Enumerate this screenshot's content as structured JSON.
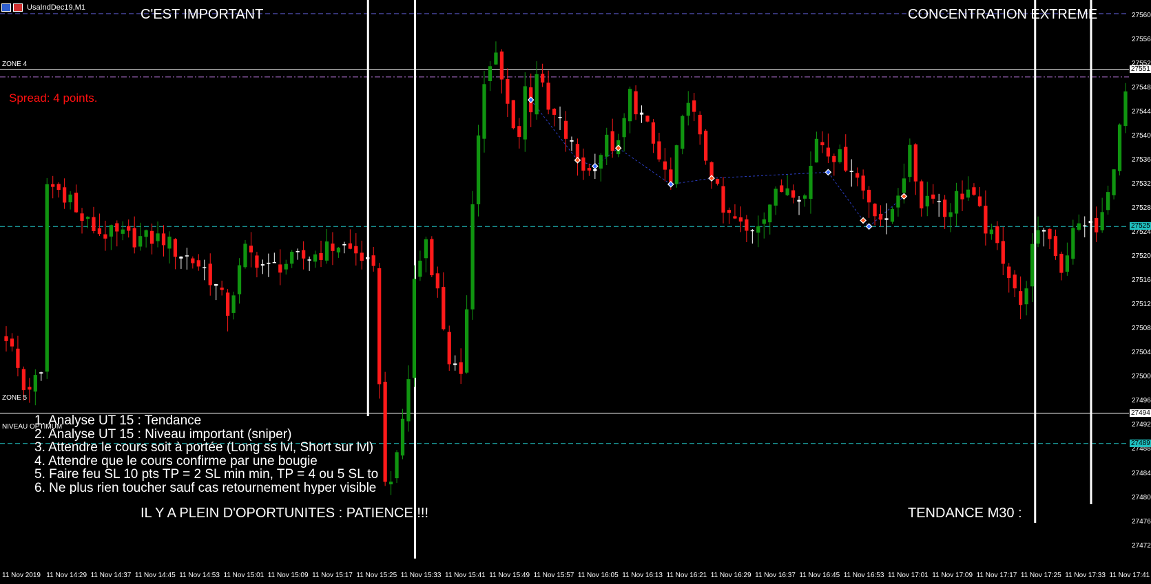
{
  "window": {
    "title": "UsaIndDec19,M1"
  },
  "annotations": {
    "top_left": "C'EST IMPORTANT",
    "top_right": "CONCENTRATION EXTREME",
    "bottom_left": "IL Y A PLEIN D'OPORTUNITES : PATIENCE !!!",
    "bottom_right": "TENDANCE M30 :",
    "spread": "Spread: 4 points."
  },
  "zones": {
    "zone4": "ZONE 4",
    "zone5": "ZONE 5",
    "niveau": "NIVEAU OPTIMUM"
  },
  "checklist": [
    "1. Analyse UT 15 : Tendance",
    "2. Analyse UT 15 : Niveau important (sniper)",
    "3. Attendre le cours soit à portée (Long ss lvl, Short sur lvl)",
    "4. Attendre que le cours confirme par une bougie",
    "5. Faire feu SL 10 pts TP = 2 SL min min, TP = 4 ou 5 SL to",
    "6. Ne plus rien toucher sauf cas retournement hyper visible"
  ],
  "price_axis": {
    "ticks": [
      "27560",
      "27556",
      "27552",
      "27548",
      "27544",
      "27540",
      "27536",
      "27532",
      "27528",
      "27524",
      "27520",
      "27516",
      "27512",
      "27508",
      "27504",
      "27500",
      "27496",
      "27492",
      "27488",
      "27484",
      "27480",
      "27476",
      "27472"
    ],
    "badges": [
      {
        "label": "27551",
        "price": 27551,
        "color": "#ffffff"
      },
      {
        "label": "27525",
        "price": 27525,
        "color": "#20c0c0"
      },
      {
        "label": "27494",
        "price": 27494,
        "color": "#ffffff"
      },
      {
        "label": "27489",
        "price": 27489,
        "color": "#20c0c0"
      }
    ]
  },
  "time_axis": [
    "11 Nov 2019",
    "11 Nov 14:29",
    "11 Nov 14:37",
    "11 Nov 14:45",
    "11 Nov 14:53",
    "11 Nov 15:01",
    "11 Nov 15:09",
    "11 Nov 15:17",
    "11 Nov 15:25",
    "11 Nov 15:33",
    "11 Nov 15:41",
    "11 Nov 15:49",
    "11 Nov 15:57",
    "11 Nov 16:05",
    "11 Nov 16:13",
    "11 Nov 16:21",
    "11 Nov 16:29",
    "11 Nov 16:37",
    "11 Nov 16:45",
    "11 Nov 16:53",
    "11 Nov 17:01",
    "11 Nov 17:09",
    "11 Nov 17:17",
    "11 Nov 17:25",
    "11 Nov 17:33",
    "11 Nov 17:41"
  ],
  "chart_data": {
    "type": "candlestick",
    "symbol": "UsaIndDec19",
    "timeframe": "M1",
    "ylim": [
      27469,
      27562
    ],
    "colors": {
      "bull": "#109410",
      "bear": "#ff1a1a",
      "doji": "#ffffff",
      "background": "#000000"
    },
    "horizontal_levels": [
      {
        "price": 27560.3,
        "style": "dash",
        "color": "#5a58c8"
      },
      {
        "price": 27551,
        "style": "solid",
        "color": "#ffffff"
      },
      {
        "price": 27549.8,
        "style": "dashdot",
        "color": "#b070d0"
      },
      {
        "price": 27525,
        "style": "dash",
        "color": "#20c0c0"
      },
      {
        "price": 27494,
        "style": "solid",
        "color": "#ffffff"
      },
      {
        "price": 27489,
        "style": "dash",
        "color": "#20c0c0"
      }
    ],
    "vertical_markers": [
      {
        "time_index": 8.05,
        "color": "#ffffff"
      },
      {
        "time_index": 9.1,
        "color": "#ffffff"
      },
      {
        "time_index": 22.95,
        "color": "#ffffff"
      },
      {
        "time_index": 24.2,
        "color": "#ffffff"
      }
    ],
    "anchors": [
      {
        "i": 0,
        "p": 27507
      },
      {
        "i": 1.5,
        "p": 27503
      },
      {
        "i": 3,
        "p": 27498
      },
      {
        "i": 6,
        "p": 27500
      },
      {
        "i": 6.5,
        "p": 27505
      },
      {
        "i": 7,
        "p": 27532
      },
      {
        "i": 9,
        "p": 27531
      },
      {
        "i": 11,
        "p": 27530
      },
      {
        "i": 12,
        "p": 27527
      },
      {
        "i": 16,
        "p": 27524
      },
      {
        "i": 22,
        "p": 27523
      },
      {
        "i": 27,
        "p": 27523
      },
      {
        "i": 29,
        "p": 27521
      },
      {
        "i": 31,
        "p": 27520
      },
      {
        "i": 34,
        "p": 27518
      },
      {
        "i": 36,
        "p": 27515
      },
      {
        "i": 38,
        "p": 27511
      },
      {
        "i": 41,
        "p": 27521
      },
      {
        "i": 45,
        "p": 27518
      },
      {
        "i": 48,
        "p": 27519
      },
      {
        "i": 52,
        "p": 27520
      },
      {
        "i": 57,
        "p": 27522
      },
      {
        "i": 61,
        "p": 27520
      },
      {
        "i": 63,
        "p": 27517
      },
      {
        "i": 64,
        "p": 27500
      },
      {
        "i": 65,
        "p": 27482
      },
      {
        "i": 67,
        "p": 27486
      },
      {
        "i": 69,
        "p": 27500
      },
      {
        "i": 70,
        "p": 27516
      },
      {
        "i": 72,
        "p": 27523
      },
      {
        "i": 74,
        "p": 27514
      },
      {
        "i": 76,
        "p": 27503
      },
      {
        "i": 78,
        "p": 27499
      },
      {
        "i": 79,
        "p": 27512
      },
      {
        "i": 80,
        "p": 27530
      },
      {
        "i": 81,
        "p": 27540
      },
      {
        "i": 82,
        "p": 27549
      },
      {
        "i": 84,
        "p": 27553
      },
      {
        "i": 86,
        "p": 27545
      },
      {
        "i": 88,
        "p": 27540
      },
      {
        "i": 89,
        "p": 27548
      },
      {
        "i": 90,
        "p": 27545
      },
      {
        "i": 91,
        "p": 27551
      },
      {
        "i": 93,
        "p": 27544
      },
      {
        "i": 95,
        "p": 27542
      },
      {
        "i": 98,
        "p": 27536
      },
      {
        "i": 100,
        "p": 27534
      },
      {
        "i": 103,
        "p": 27539
      },
      {
        "i": 105,
        "p": 27538
      },
      {
        "i": 107,
        "p": 27547
      },
      {
        "i": 110,
        "p": 27541
      },
      {
        "i": 112,
        "p": 27536
      },
      {
        "i": 114,
        "p": 27532
      },
      {
        "i": 116,
        "p": 27542
      },
      {
        "i": 117,
        "p": 27547
      },
      {
        "i": 119,
        "p": 27539
      },
      {
        "i": 121,
        "p": 27534
      },
      {
        "i": 123,
        "p": 27527
      },
      {
        "i": 125,
        "p": 27526
      },
      {
        "i": 127,
        "p": 27524
      },
      {
        "i": 129,
        "p": 27526
      },
      {
        "i": 131,
        "p": 27529
      },
      {
        "i": 134,
        "p": 27532
      },
      {
        "i": 137,
        "p": 27530
      },
      {
        "i": 139,
        "p": 27540
      },
      {
        "i": 142,
        "p": 27537
      },
      {
        "i": 145,
        "p": 27535
      },
      {
        "i": 147,
        "p": 27531
      },
      {
        "i": 149,
        "p": 27528
      },
      {
        "i": 151,
        "p": 27525
      },
      {
        "i": 153,
        "p": 27531
      },
      {
        "i": 155,
        "p": 27537
      },
      {
        "i": 157,
        "p": 27529
      },
      {
        "i": 159,
        "p": 27531
      },
      {
        "i": 161,
        "p": 27527
      },
      {
        "i": 163,
        "p": 27530
      },
      {
        "i": 165,
        "p": 27531
      },
      {
        "i": 167,
        "p": 27527
      },
      {
        "i": 169,
        "p": 27523
      },
      {
        "i": 171,
        "p": 27520
      },
      {
        "i": 173,
        "p": 27515
      },
      {
        "i": 174,
        "p": 27511
      },
      {
        "i": 176,
        "p": 27521
      },
      {
        "i": 178,
        "p": 27525
      },
      {
        "i": 180,
        "p": 27521
      },
      {
        "i": 181,
        "p": 27518
      },
      {
        "i": 183,
        "p": 27524
      },
      {
        "i": 185,
        "p": 27526
      },
      {
        "i": 187,
        "p": 27524
      },
      {
        "i": 189,
        "p": 27530
      },
      {
        "i": 190,
        "p": 27536
      },
      {
        "i": 191,
        "p": 27541
      },
      {
        "i": 192,
        "p": 27547
      }
    ],
    "signals": [
      {
        "i": 90,
        "p": 27546,
        "kind": "buy"
      },
      {
        "i": 98,
        "p": 27536,
        "kind": "sell"
      },
      {
        "i": 101,
        "p": 27535,
        "kind": "buy"
      },
      {
        "i": 105,
        "p": 27538,
        "kind": "sell"
      },
      {
        "i": 114,
        "p": 27532,
        "kind": "buy"
      },
      {
        "i": 121,
        "p": 27533,
        "kind": "sell"
      },
      {
        "i": 141,
        "p": 27534,
        "kind": "buy"
      },
      {
        "i": 147,
        "p": 27526,
        "kind": "sell"
      },
      {
        "i": 148,
        "p": 27525,
        "kind": "buy"
      },
      {
        "i": 154,
        "p": 27530,
        "kind": "sell"
      }
    ]
  }
}
